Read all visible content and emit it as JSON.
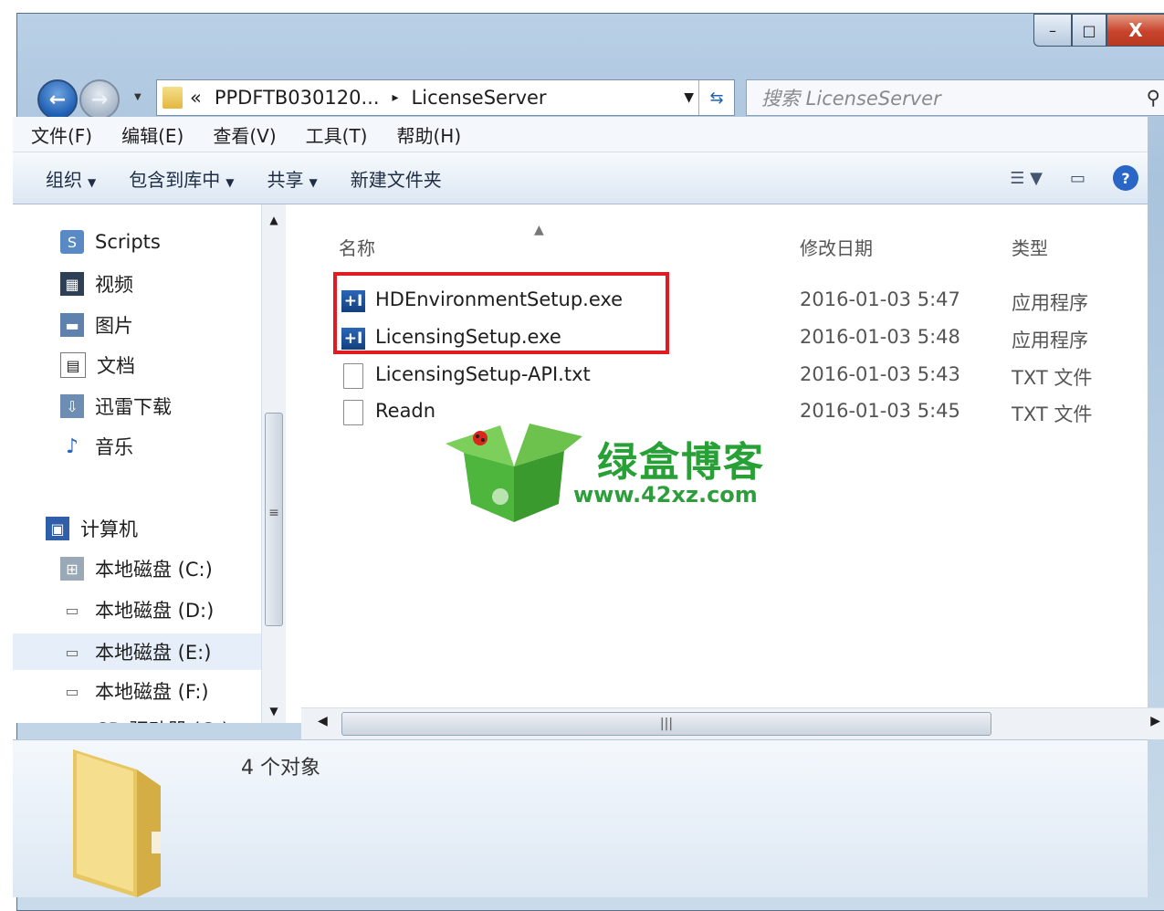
{
  "window": {
    "controls": {
      "minimize": "–",
      "maximize": "□",
      "close": "X"
    }
  },
  "address": {
    "chevron": "«",
    "parts": [
      "PPDFTB030120...",
      "LicenseServer"
    ],
    "separator": "▸"
  },
  "search": {
    "placeholder": "搜索 LicenseServer"
  },
  "menu": [
    "文件(F)",
    "编辑(E)",
    "查看(V)",
    "工具(T)",
    "帮助(H)"
  ],
  "toolbar": {
    "organize": "组织",
    "include_in_library": "包含到库中",
    "share": "共享",
    "new_folder": "新建文件夹"
  },
  "nav": {
    "items": [
      {
        "label": "Scripts",
        "icon": "script-icon"
      },
      {
        "label": "视频",
        "icon": "video-icon"
      },
      {
        "label": "图片",
        "icon": "picture-icon"
      },
      {
        "label": "文档",
        "icon": "document-icon"
      },
      {
        "label": "迅雷下载",
        "icon": "download-icon"
      },
      {
        "label": "音乐",
        "icon": "music-icon"
      }
    ],
    "computer": "计算机",
    "drives": [
      {
        "label": "本地磁盘 (C:)",
        "icon": "system-drive-icon"
      },
      {
        "label": "本地磁盘 (D:)",
        "icon": "drive-icon"
      },
      {
        "label": "本地磁盘 (E:)",
        "icon": "drive-icon",
        "selected": true
      },
      {
        "label": "本地磁盘 (F:)",
        "icon": "drive-icon"
      },
      {
        "label": "CD 驱动器 (G:)",
        "icon": "cd-drive-icon"
      }
    ]
  },
  "columns": {
    "name": "名称",
    "modified": "修改日期",
    "type": "类型"
  },
  "files": [
    {
      "name": "HDEnvironmentSetup.exe",
      "date": "2016-01-03 5:47",
      "type": "应用程序",
      "icon": "exe-icon",
      "highlighted": true
    },
    {
      "name": "LicensingSetup.exe",
      "date": "2016-01-03 5:48",
      "type": "应用程序",
      "icon": "exe-icon",
      "highlighted": true
    },
    {
      "name": "LicensingSetup-API.txt",
      "date": "2016-01-03 5:43",
      "type": "TXT 文件",
      "icon": "txt-icon"
    },
    {
      "name": "Readn",
      "date": "2016-01-03 5:45",
      "type": "TXT 文件",
      "icon": "txt-icon"
    }
  ],
  "status": {
    "count": "4 个对象"
  },
  "watermark": {
    "title": "绿盒博客",
    "url": "www.42xz.com"
  },
  "colors": {
    "highlight_box": "#e11b22",
    "watermark_green": "#27a035",
    "accent_blue": "#1f5fb3"
  }
}
